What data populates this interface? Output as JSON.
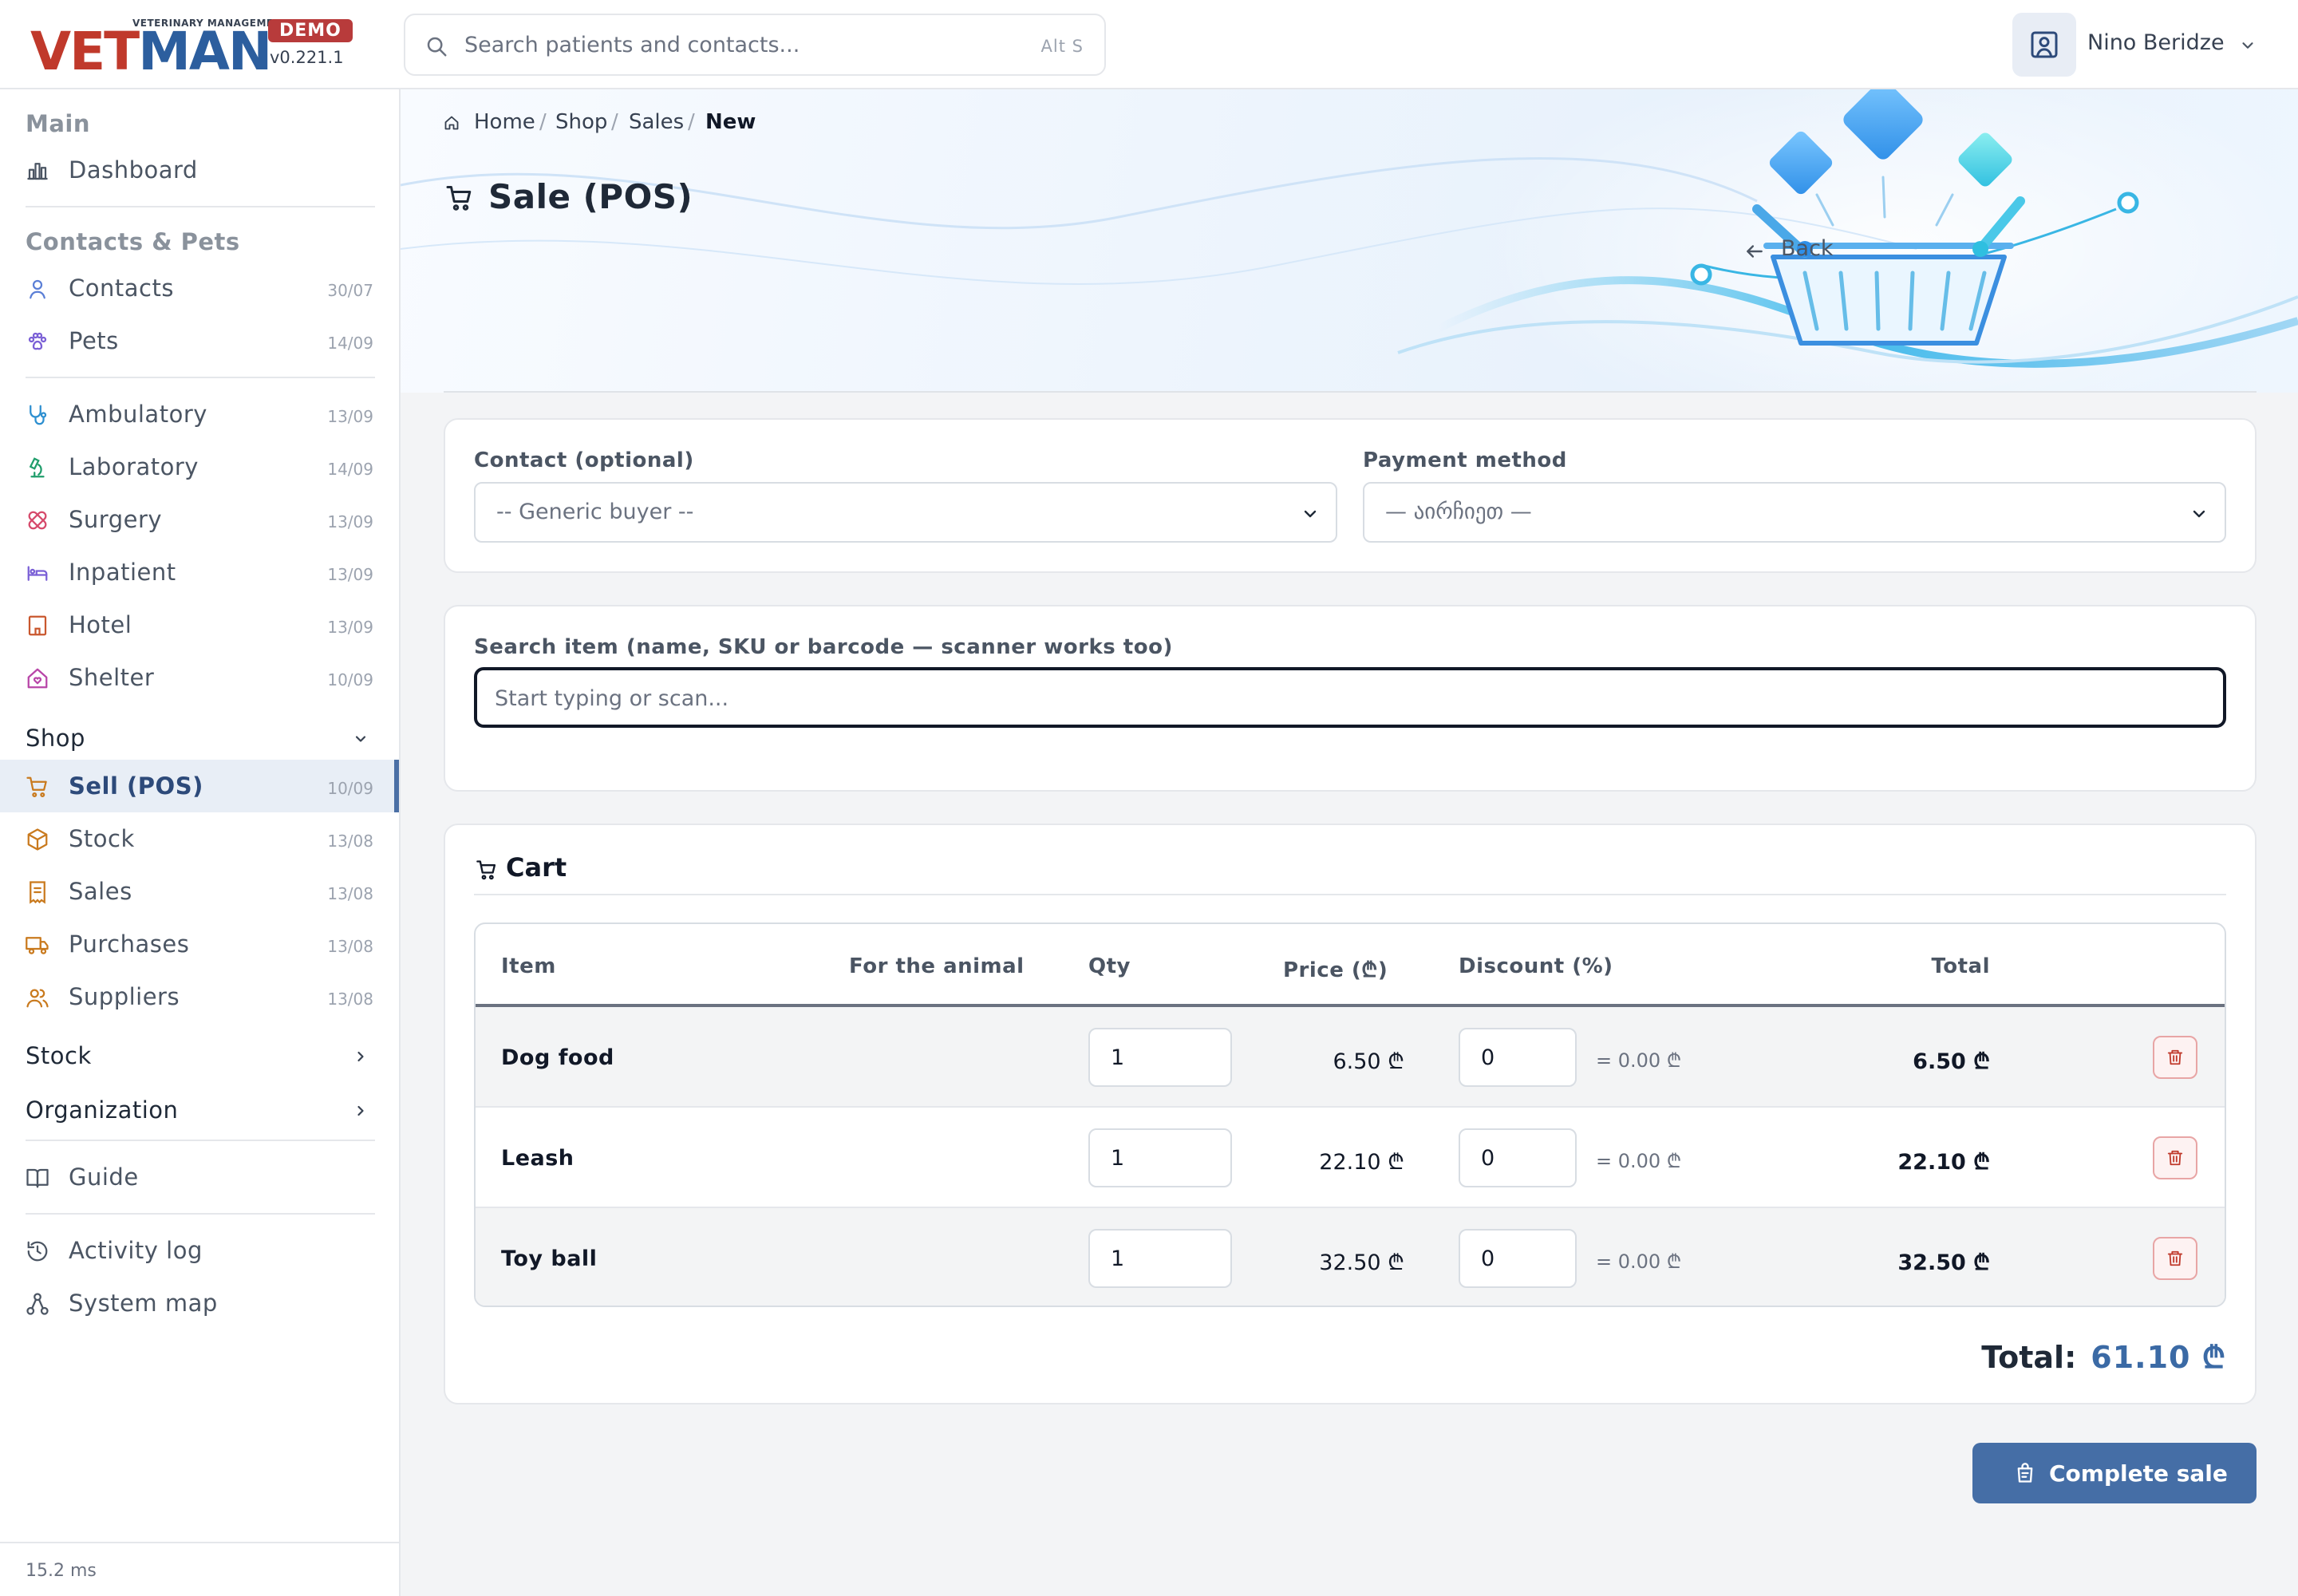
{
  "brand": {
    "tagline": "VETERINARY MANAGEMENT",
    "name_part1": "VET",
    "name_part2": "MAN",
    "badge": "DEMO",
    "version": "v0.221.1",
    "colors": {
      "vet": "#c0392b",
      "man": "#2c5e9e",
      "badge": "#b83b3b"
    }
  },
  "search": {
    "placeholder": "Search patients and contacts...",
    "shortcut": "Alt S"
  },
  "user": {
    "name": "Nino Beridze"
  },
  "sidebar": {
    "sections": {
      "main": "Main",
      "contacts_pets": "Contacts & Pets",
      "shop": "Shop",
      "stock": "Stock",
      "organization": "Organization"
    },
    "items": {
      "dashboard": {
        "label": "Dashboard",
        "icon": "chart-icon"
      },
      "contacts": {
        "label": "Contacts",
        "date": "30/07",
        "icon": "person-icon"
      },
      "pets": {
        "label": "Pets",
        "date": "14/09",
        "icon": "paw-icon"
      },
      "ambulatory": {
        "label": "Ambulatory",
        "date": "13/09",
        "icon": "stethoscope-icon"
      },
      "laboratory": {
        "label": "Laboratory",
        "date": "14/09",
        "icon": "microscope-icon"
      },
      "surgery": {
        "label": "Surgery",
        "date": "13/09",
        "icon": "bandage-icon"
      },
      "inpatient": {
        "label": "Inpatient",
        "date": "13/09",
        "icon": "bed-icon"
      },
      "hotel": {
        "label": "Hotel",
        "date": "13/09",
        "icon": "building-icon"
      },
      "shelter": {
        "label": "Shelter",
        "date": "10/09",
        "icon": "house-heart-icon"
      },
      "sell_pos": {
        "label": "Sell (POS)",
        "date": "10/09",
        "icon": "cart-icon"
      },
      "stock": {
        "label": "Stock",
        "date": "13/08",
        "icon": "box-icon"
      },
      "sales": {
        "label": "Sales",
        "date": "13/08",
        "icon": "receipt-icon"
      },
      "purchases": {
        "label": "Purchases",
        "date": "13/08",
        "icon": "truck-icon"
      },
      "suppliers": {
        "label": "Suppliers",
        "date": "13/08",
        "icon": "people-icon"
      },
      "guide": {
        "label": "Guide",
        "icon": "book-icon"
      },
      "activity_log": {
        "label": "Activity log",
        "icon": "history-icon"
      },
      "system_map": {
        "label": "System map",
        "icon": "diagram-icon"
      }
    },
    "footer": "15.2 ms"
  },
  "breadcrumb": [
    "Home",
    "Shop",
    "Sales",
    "New"
  ],
  "page": {
    "title": "Sale (POS)",
    "back": "Back"
  },
  "form": {
    "contact_label": "Contact (optional)",
    "contact_value": "-- Generic buyer --",
    "payment_label": "Payment method",
    "payment_value": "— აირჩიეთ —",
    "item_search_label": "Search item (name, SKU or barcode — scanner works too)",
    "item_search_placeholder": "Start typing or scan..."
  },
  "cart": {
    "title": "Cart",
    "columns": [
      "Item",
      "For the animal",
      "Qty",
      "Price (₾)",
      "Discount (%)",
      "Total"
    ],
    "rows": [
      {
        "item": "Dog food",
        "qty": "1",
        "price": "6.50 ₾",
        "discount": "0",
        "discount_sum": "= 0.00 ₾",
        "total": "6.50 ₾"
      },
      {
        "item": "Leash",
        "qty": "1",
        "price": "22.10 ₾",
        "discount": "0",
        "discount_sum": "= 0.00 ₾",
        "total": "22.10 ₾"
      },
      {
        "item": "Toy ball",
        "qty": "1",
        "price": "32.50 ₾",
        "discount": "0",
        "discount_sum": "= 0.00 ₾",
        "total": "32.50 ₾"
      }
    ],
    "total_label": "Total:",
    "total_value": "61.10 ₾"
  },
  "actions": {
    "complete": "Complete sale"
  },
  "colors": {
    "accent": "#456ea6",
    "active_nav_bg": "#e8eef6",
    "danger": "#c0392b"
  }
}
